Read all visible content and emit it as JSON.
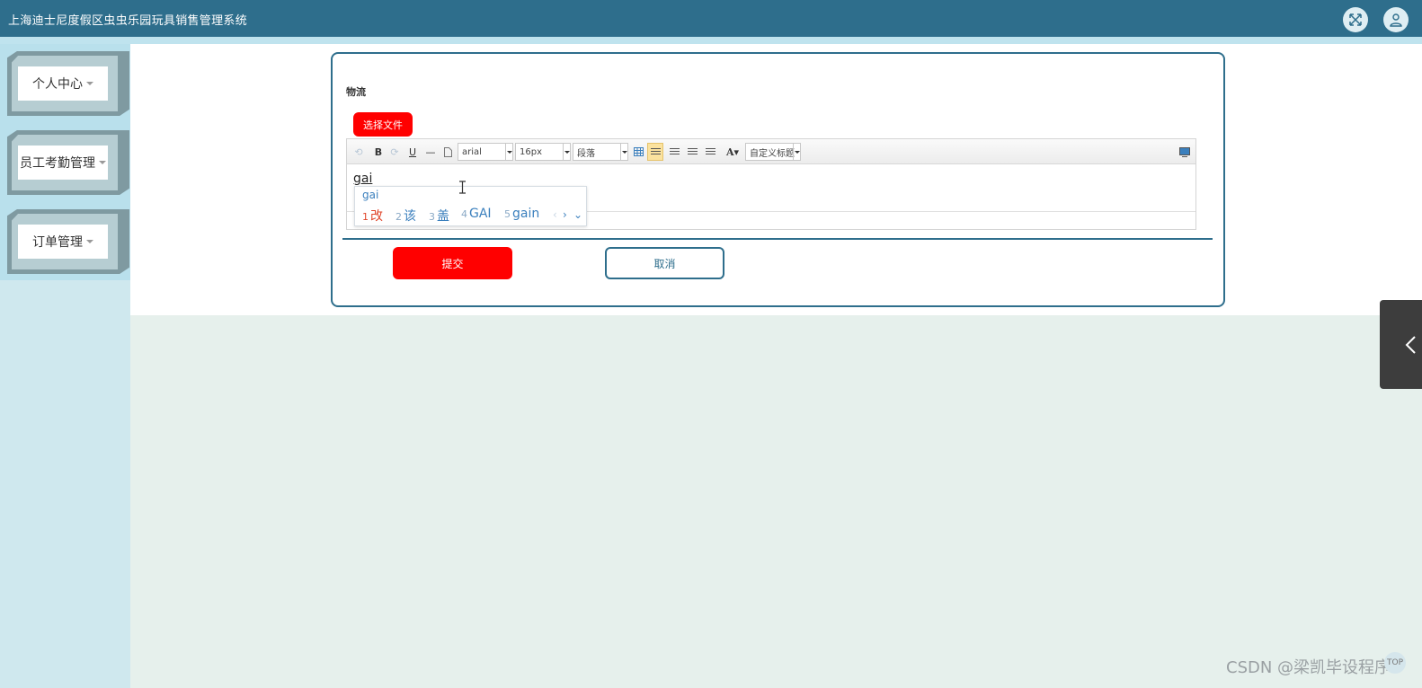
{
  "header": {
    "title": "上海迪士尼度假区虫虫乐园玩具销售管理系统",
    "fullscreen_icon": "expand-icon",
    "user_icon": "user-icon"
  },
  "sidebar": {
    "items": [
      {
        "label": "个人中心"
      },
      {
        "label": "员工考勤管理"
      },
      {
        "label": "订单管理"
      }
    ]
  },
  "form": {
    "field_label": "物流",
    "file_button": "选择文件",
    "toolbar": {
      "font_family": "arial",
      "font_size": "16px",
      "paragraph": "段落",
      "custom_title": "自定义标题"
    },
    "editor_text": "gai",
    "submit_label": "提交",
    "cancel_label": "取消"
  },
  "ime": {
    "pinyin": "gai",
    "candidates": [
      {
        "num": "1",
        "text": "改"
      },
      {
        "num": "2",
        "text": "该"
      },
      {
        "num": "3",
        "text": "盖"
      },
      {
        "num": "4",
        "text": "GAI"
      },
      {
        "num": "5",
        "text": "gain"
      }
    ]
  },
  "footer": {
    "watermark": "CSDN @梁凯毕设程序",
    "top_label": "TOP"
  },
  "colors": {
    "header": "#2e6e8c",
    "accent_red": "#ff0000",
    "sidebar": "#b9e0ec"
  }
}
